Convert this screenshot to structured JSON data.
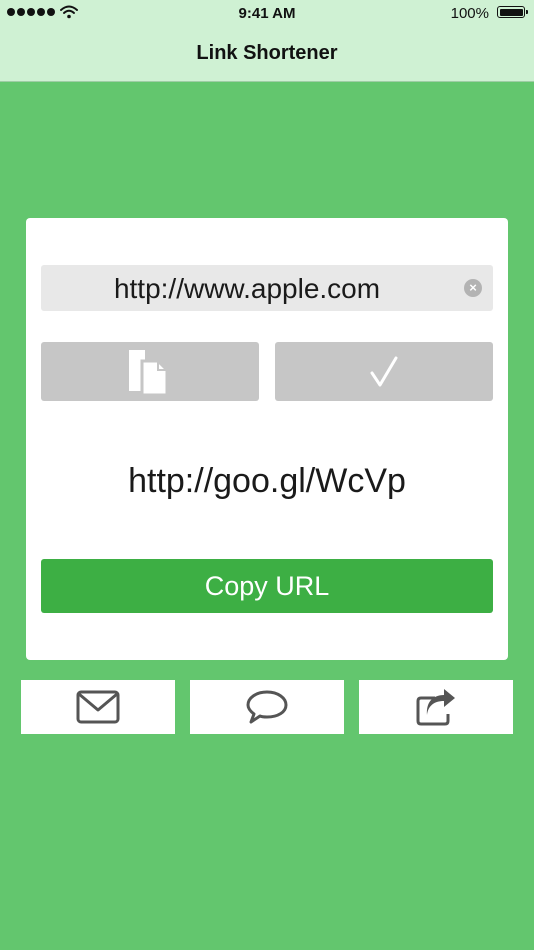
{
  "status_bar": {
    "time": "9:41 AM",
    "battery_percent": "100%",
    "icons": [
      "signal-dots-icon",
      "wifi-icon",
      "battery-icon"
    ]
  },
  "nav": {
    "title": "Link Shortener"
  },
  "card": {
    "url_input_value": "http://www.apple.com",
    "clear_icon": "×",
    "paste_icon": "paste-documents-icon",
    "shorten_icon": "checkmark-icon",
    "shorten_glyph": "✓",
    "short_url": "http://goo.gl/WcVp",
    "copy_label": "Copy URL"
  },
  "share": {
    "icons": [
      "envelope-icon",
      "speech-bubble-icon",
      "share-arrow-icon"
    ]
  },
  "colors": {
    "background": "#63c66e",
    "header": "#cff1d3",
    "copy_button": "#3daf44",
    "action_button": "#c6c6c6",
    "input_field": "#e8e8e8"
  }
}
